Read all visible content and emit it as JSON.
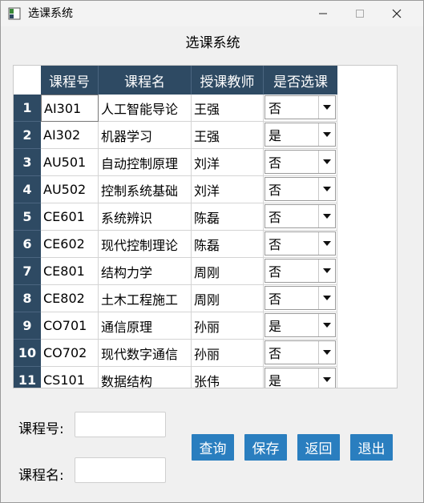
{
  "window": {
    "title": "选课系统",
    "controls": {
      "minimize": "–",
      "maximize": "☐",
      "close": "✕"
    }
  },
  "page": {
    "title": "选课系统"
  },
  "table": {
    "headers": [
      "课程号",
      "课程名",
      "授课教师",
      "是否选课"
    ],
    "rows": [
      {
        "num": "1",
        "id": "AI301",
        "name": "人工智能导论",
        "teacher": "王强",
        "selected": "否"
      },
      {
        "num": "2",
        "id": "AI302",
        "name": "机器学习",
        "teacher": "王强",
        "selected": "是"
      },
      {
        "num": "3",
        "id": "AU501",
        "name": "自动控制原理",
        "teacher": "刘洋",
        "selected": "否"
      },
      {
        "num": "4",
        "id": "AU502",
        "name": "控制系统基础",
        "teacher": "刘洋",
        "selected": "否"
      },
      {
        "num": "5",
        "id": "CE601",
        "name": "系统辨识",
        "teacher": "陈磊",
        "selected": "否"
      },
      {
        "num": "6",
        "id": "CE602",
        "name": "现代控制理论",
        "teacher": "陈磊",
        "selected": "否"
      },
      {
        "num": "7",
        "id": "CE801",
        "name": "结构力学",
        "teacher": "周刚",
        "selected": "否"
      },
      {
        "num": "8",
        "id": "CE802",
        "name": "土木工程施工",
        "teacher": "周刚",
        "selected": "否"
      },
      {
        "num": "9",
        "id": "CO701",
        "name": "通信原理",
        "teacher": "孙丽",
        "selected": "是"
      },
      {
        "num": "10",
        "id": "CO702",
        "name": "现代数字通信",
        "teacher": "孙丽",
        "selected": "否"
      },
      {
        "num": "11",
        "id": "CS101",
        "name": "数据结构",
        "teacher": "张伟",
        "selected": "是"
      }
    ]
  },
  "form": {
    "course_id_label": "课程号:",
    "course_name_label": "课程名:",
    "course_id_value": "",
    "course_name_value": ""
  },
  "buttons": {
    "query": "查询",
    "save": "保存",
    "back": "返回",
    "exit": "退出"
  },
  "colors": {
    "header_bg": "#2e4a63",
    "button_bg": "#2a7ebf"
  }
}
